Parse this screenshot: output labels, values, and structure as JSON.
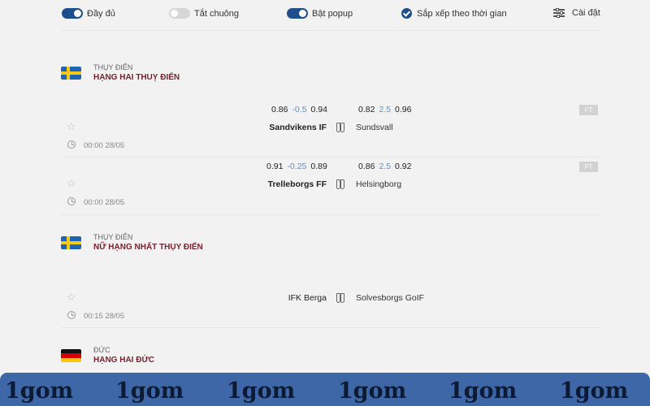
{
  "toolbar": {
    "full": {
      "label": "Đầy đủ",
      "enabled": true
    },
    "mute_all": {
      "label": "Tắt chuông",
      "enabled": false
    },
    "popup": {
      "label": "Bật popup",
      "enabled": true
    },
    "sort_by_time": {
      "label": "Sắp xếp theo thời gian",
      "checked": true
    },
    "settings": {
      "label": "Cài đặt"
    }
  },
  "sections": [
    {
      "country": "THỤY ĐIỂN",
      "league": "HẠNG HAI THUỴ ĐIỂN",
      "flag": "sweden-flag",
      "matches": [
        {
          "odds_left": {
            "a": "0.86",
            "handicap": "-0.5",
            "b": "0.94"
          },
          "odds_right": {
            "a": "0.82",
            "handicap": "2.5",
            "b": "0.96"
          },
          "status": "FT",
          "home": "Sandvikens IF",
          "away": "Sundsvall",
          "time": "00:00 28/05"
        },
        {
          "odds_left": {
            "a": "0.91",
            "handicap": "-0.25",
            "b": "0.89"
          },
          "odds_right": {
            "a": "0.86",
            "handicap": "2.5",
            "b": "0.92"
          },
          "status": "FT",
          "home": "Trelleborgs FF",
          "away": "Helsingborg",
          "time": "00:00 28/05"
        }
      ]
    },
    {
      "country": "THỤY ĐIỂN",
      "league": "NỮ HẠNG NHẤT THỤY ĐIỂN",
      "flag": "sweden-flag",
      "matches": [
        {
          "home": "IFK Berga",
          "away": "Solvesborgs GoIF",
          "time": "00:15 28/05"
        }
      ]
    },
    {
      "country": "ĐỨC",
      "league": "HẠNG HAI ĐỨC",
      "flag": "germany-flag",
      "matches": []
    }
  ],
  "watermark": {
    "text": "1gom"
  },
  "colors": {
    "accent": "#1f4e8c",
    "league_title": "#7a1f2e",
    "handicap": "#5a8fd8",
    "watermark_bar": "#3e67a8"
  },
  "icons": {
    "favorite": "star-icon",
    "time": "clock-icon",
    "vs": "jersey-icon",
    "settings": "sliders-icon"
  }
}
